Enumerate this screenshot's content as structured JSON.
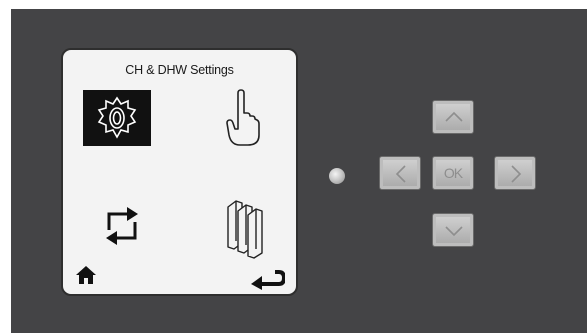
{
  "screen": {
    "title": "CH & DHW Settings",
    "menu": [
      {
        "icon": "settings-gear-icon"
      },
      {
        "icon": "hand-pointer-icon"
      },
      {
        "icon": "switch-arrows-icon"
      },
      {
        "icon": "radiator-icon"
      }
    ],
    "footer": {
      "left_icon": "home-icon",
      "right_icon": "back-arrow-icon"
    }
  },
  "keypad": {
    "ok_label": "OK",
    "keys": [
      "up",
      "left",
      "ok",
      "right",
      "down"
    ]
  },
  "colors": {
    "panel": "#444446",
    "screen_bg": "#f3f3f3",
    "key_face": "#c4c4c4",
    "selected_bg": "#111111"
  }
}
